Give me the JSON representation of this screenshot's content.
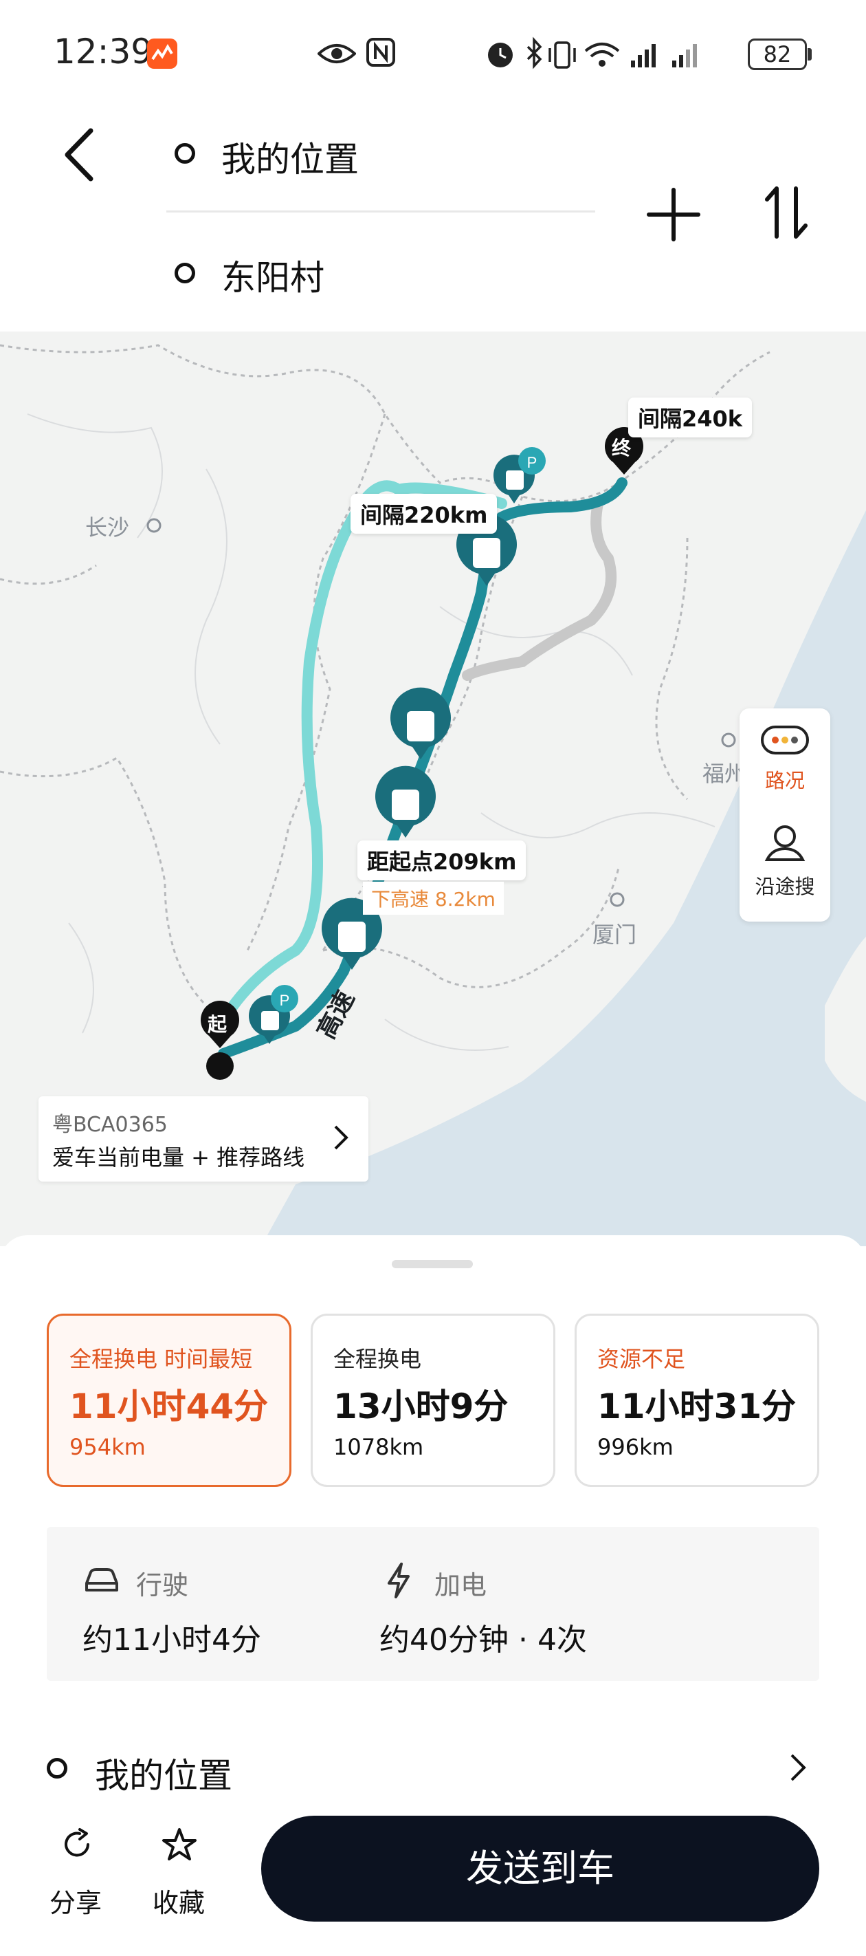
{
  "status_bar": {
    "time": "12:39",
    "battery": "82",
    "icons": [
      "app-notification-icon",
      "eye-icon",
      "nfc-icon",
      "alarm-icon",
      "bluetooth-icon",
      "vibrate-icon",
      "wifi-icon",
      "signal-icon",
      "signal-icon-2",
      "battery-icon"
    ]
  },
  "route": {
    "origin": "我的位置",
    "destination": "东阳村"
  },
  "map": {
    "cities": {
      "changsha": "长沙",
      "fuzhou": "福州",
      "xiamen": "厦门"
    },
    "labels": {
      "interval_220": "间隔220km",
      "interval_240": "间隔240k",
      "from_start": "距起点209km",
      "exit_highway": "下高速 8.2km",
      "highway_road": "高速",
      "start_marker": "起",
      "end_marker": "终"
    },
    "tools": {
      "traffic": "路况",
      "along_search": "沿途搜"
    },
    "car_card": {
      "plate": "粤BCA0365",
      "tip": "爱车当前电量 + 推荐路线"
    },
    "colors": {
      "route_selected": "#1f8d9a",
      "route_alt": "#7dd9d6",
      "route_gray": "#cccccc",
      "station": "#1a6e7c",
      "sea": "#d8e4ec"
    }
  },
  "plans": [
    {
      "label": "全程换电 时间最短",
      "time": "11小时44分",
      "distance": "954km",
      "selected": true
    },
    {
      "label": "全程换电",
      "time": "13小时9分",
      "distance": "1078km",
      "selected": false
    },
    {
      "label": "资源不足",
      "time": "11小时31分",
      "distance": "996km",
      "selected": false
    }
  ],
  "summary": {
    "drive_label": "行驶",
    "drive_value": "约11小时4分",
    "charge_label": "加电",
    "charge_value": "约40分钟 · 4次"
  },
  "start_row": {
    "label": "我的位置"
  },
  "actions": {
    "share": "分享",
    "favorite": "收藏",
    "send": "发送到车"
  },
  "accent_color": "#e0541f"
}
